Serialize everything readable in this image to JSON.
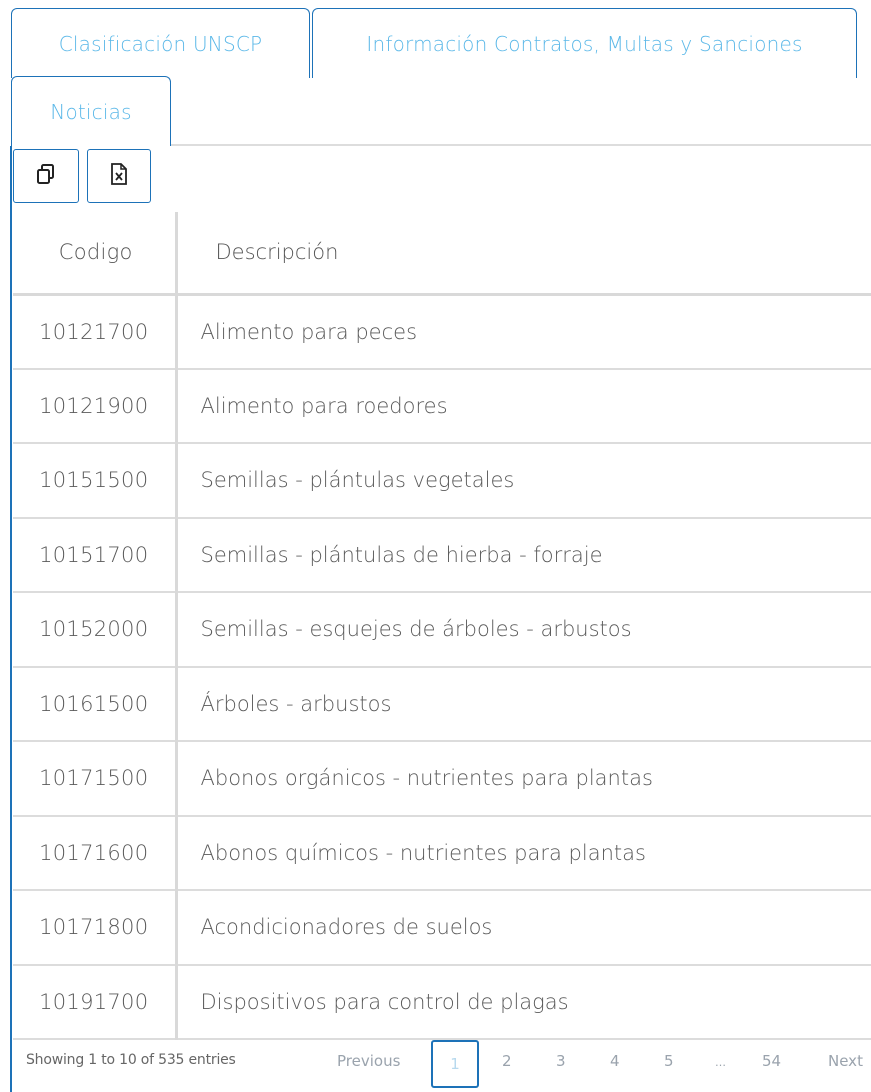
{
  "tabs": [
    {
      "label": "Clasificación UNSCP"
    },
    {
      "label": "Información Contratos, Multas y Sanciones"
    },
    {
      "label": "Noticias"
    }
  ],
  "toolbar": {
    "copy_icon": "copy-icon",
    "excel_icon": "excel-file-icon"
  },
  "table": {
    "headers": [
      "Codigo",
      "Descripción"
    ],
    "rows": [
      [
        "10121700",
        "Alimento para peces"
      ],
      [
        "10121900",
        "Alimento para roedores"
      ],
      [
        "10151500",
        "Semillas - plántulas vegetales"
      ],
      [
        "10151700",
        "Semillas - plántulas de hierba - forraje"
      ],
      [
        "10152000",
        "Semillas - esquejes de árboles - arbustos"
      ],
      [
        "10161500",
        "Árboles - arbustos"
      ],
      [
        "10171500",
        "Abonos orgánicos - nutrientes para plantas"
      ],
      [
        "10171600",
        "Abonos químicos - nutrientes para plantas"
      ],
      [
        "10171800",
        "Acondicionadores de suelos"
      ],
      [
        "10191700",
        "Dispositivos para control de plagas"
      ]
    ]
  },
  "footer": {
    "info": "Showing 1 to 10 of 535 entries",
    "previous": "Previous",
    "current_page": "1",
    "pages": [
      "2",
      "3",
      "4",
      "5"
    ],
    "ellipsis": "…",
    "last_page": "54",
    "next": "Next"
  },
  "colors": {
    "accent": "#1d72b8",
    "tab_text": "#5bb8e8"
  }
}
